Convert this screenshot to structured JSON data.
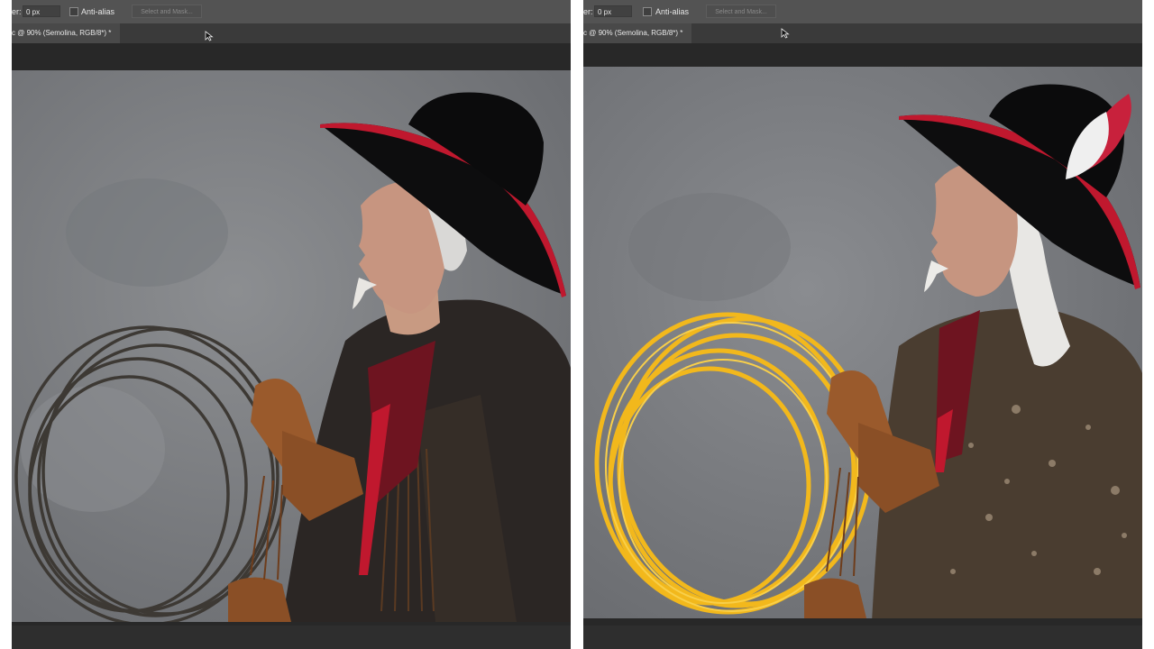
{
  "left_panel": {
    "options": {
      "feather_label": "er:",
      "feather_value": "0 px",
      "antialias_label": "Anti-alias",
      "select_mask_label": "Select and Mask..."
    },
    "doc_tab": "c @ 90% (Semolina, RGB/8*) *"
  },
  "right_panel": {
    "options": {
      "feather_label": "er:",
      "feather_value": "0 px",
      "antialias_label": "Anti-alias",
      "select_mask_label": "Select and Mask..."
    },
    "doc_tab": "c @ 90% (Semolina, RGB/8*) *"
  },
  "colors": {
    "ui_dark": "#2b2b2b",
    "options_bar": "#535353",
    "backdrop": "#7d7f82",
    "hat_brim_red": "#c0182e",
    "glove_brown": "#9a5a2c",
    "pasta_yellow": "#f2b81c"
  },
  "icons": [
    "arrow-cursor-icon"
  ]
}
